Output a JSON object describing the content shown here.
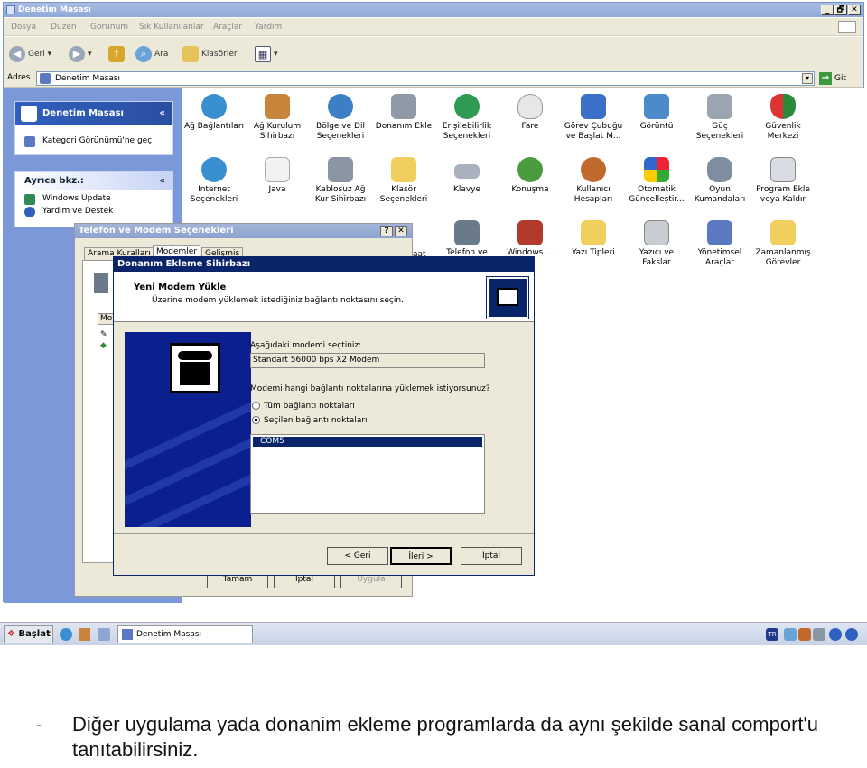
{
  "window": {
    "title": "Denetim Masası",
    "caption_buttons": [
      "_",
      "🗗",
      "✕"
    ]
  },
  "menu": [
    "Dosya",
    "Düzen",
    "Görünüm",
    "Sık Kullanılanlar",
    "Araçlar",
    "Yardım"
  ],
  "toolbar": {
    "back": "Geri",
    "search": "Ara",
    "folders": "Klasörler"
  },
  "address": {
    "label": "Adres",
    "value": "Denetim Masası",
    "go": "Git"
  },
  "left_panel": {
    "panel1_title": "Denetim Masası",
    "panel1_link": "Kategori Görünümü'ne geç",
    "panel2_title": "Ayrıca bkz.:",
    "panel2_links": [
      "Windows Update",
      "Yardım ve Destek"
    ]
  },
  "icons": [
    "Ağ Bağlantıları",
    "Ağ Kurulum Sihirbazı",
    "Bölge ve Dil Seçenekleri",
    "Donanım Ekle",
    "Erişilebilirlik Seçenekleri",
    "Fare",
    "Görev Çubuğu ve Başlat M...",
    "Görüntü",
    "Güç Seçenekleri",
    "Güvenlik Merkezi",
    "Internet Seçenekleri",
    "Java",
    "Kablosuz Ağ Kur Sihirbazı",
    "Klasör Seçenekleri",
    "Klavye",
    "Konuşma",
    "Kullanıcı Hesapları",
    "Otomatik Güncelleştir...",
    "Oyun Kumandaları",
    "Program Ekle veya Kaldır",
    "Telefon ve",
    "Windows ...",
    "Yazı Tipleri",
    "Yazıcı ve Fakslar",
    "Yönetimsel Araçlar",
    "Zamanlanmış Görevler"
  ],
  "telwin": {
    "title": "Telefon ve Modem Seçenekleri",
    "tabs": [
      "Arama Kuralları",
      "Modemler",
      "Gelişmiş"
    ],
    "list_header": "Mo",
    "buttons": [
      "Tamam",
      "İptal",
      "Uygula"
    ],
    "behind_text": "aat"
  },
  "wizard": {
    "title": "Donanım Ekleme Sihirbazı",
    "header_title": "Yeni Modem Yükle",
    "header_sub": "Üzerine modem yüklemek istediğiniz bağlantı noktasını seçin.",
    "modem_label": "Aşağıdaki modemi seçtiniz:",
    "modem_value": "Standart 56000 bps X2 Modem",
    "ports_question": "Modemi hangi bağlantı noktalarına yüklemek istiyorsunuz?",
    "radio_all": "Tüm bağlantı noktaları",
    "radio_selected": "Seçilen bağlantı noktaları",
    "selected_radio": "radio_selected",
    "ports": [
      "COM5"
    ],
    "buttons": {
      "back": "< Geri",
      "next": "İleri >",
      "cancel": "İptal"
    }
  },
  "taskbar": {
    "start": "Başlat",
    "task": "Denetim Masası",
    "lang": "TR"
  },
  "caption": {
    "dash": "-",
    "text": "Diğer uygulama yada donanim ekleme programlarda da aynı şekilde sanal comport'u tanıtabilirsiniz."
  }
}
